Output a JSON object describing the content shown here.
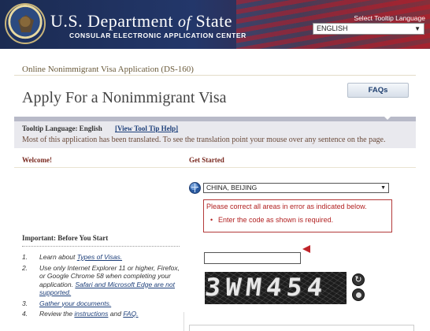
{
  "header": {
    "title_main": "U.S. Department",
    "title_of": "of",
    "title_state": "State",
    "subtitle": "CONSULAR ELECTRONIC APPLICATION CENTER",
    "tooltip_language_label": "Select Tooltip Language",
    "language_value": "ENGLISH"
  },
  "page": {
    "app_name": "Online Nonimmigrant Visa Application (DS-160)",
    "title": "Apply For a Nonimmigrant Visa",
    "faqs_button": "FAQs"
  },
  "tooltip_bar": {
    "language_text": "Tooltip Language: English",
    "view_link": "[View Tool Tip Help]",
    "message": "Most of this application has been translated. To see the translation point your mouse over any sentence on the page."
  },
  "sections": {
    "welcome": "Welcome!",
    "get_started": "Get Started",
    "important": "Important: Before You Start"
  },
  "location": {
    "selected": "CHINA, BEIJING"
  },
  "errors": {
    "title": "Please correct all areas in error as indicated below.",
    "items": [
      "Enter the code as shown is required."
    ]
  },
  "steps": [
    {
      "num": "1.",
      "pre": "Learn about ",
      "link": "Types of Visas.",
      "post": ""
    },
    {
      "num": "2.",
      "pre": "Use only Internet Explorer 11 or higher, Firefox, or Google Chrome 58 when completing your application. ",
      "link": "Safari and Microsoft Edge are not supported.",
      "post": ""
    },
    {
      "num": "3.",
      "pre": "",
      "link": "Gather your documents.",
      "post": ""
    },
    {
      "num": "4.",
      "pre": "Review the ",
      "link": "instructions",
      "post": " and ",
      "link2": "FAQ."
    }
  ],
  "captcha": {
    "code": "3WM454",
    "input_value": ""
  },
  "colors": {
    "header_blue": "#1b2b52",
    "header_red": "#7a1e2a",
    "error_red": "#b22222",
    "link_blue": "#1d3f7a"
  },
  "icons": [
    "seal-icon",
    "globe-icon",
    "refresh-icon",
    "audio-icon",
    "error-marker-icon"
  ]
}
